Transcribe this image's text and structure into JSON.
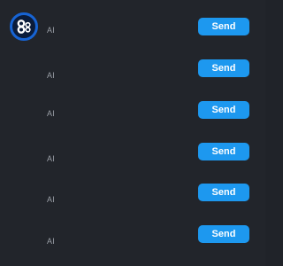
{
  "messages": [
    {
      "sender": "AI",
      "action_label": "Send"
    },
    {
      "sender": "AI",
      "action_label": "Send"
    },
    {
      "sender": "AI",
      "action_label": "Send"
    },
    {
      "sender": "AI",
      "action_label": "Send"
    },
    {
      "sender": "AI",
      "action_label": "Send"
    },
    {
      "sender": "AI",
      "action_label": "Send"
    }
  ],
  "avatar": {
    "icon": "bot-avatar-icon"
  },
  "colors": {
    "background": "#22252b",
    "button": "#1d98ef",
    "button_text": "#ffffff",
    "label": "#9a9ea6",
    "avatar_ring": "#1764d4"
  }
}
